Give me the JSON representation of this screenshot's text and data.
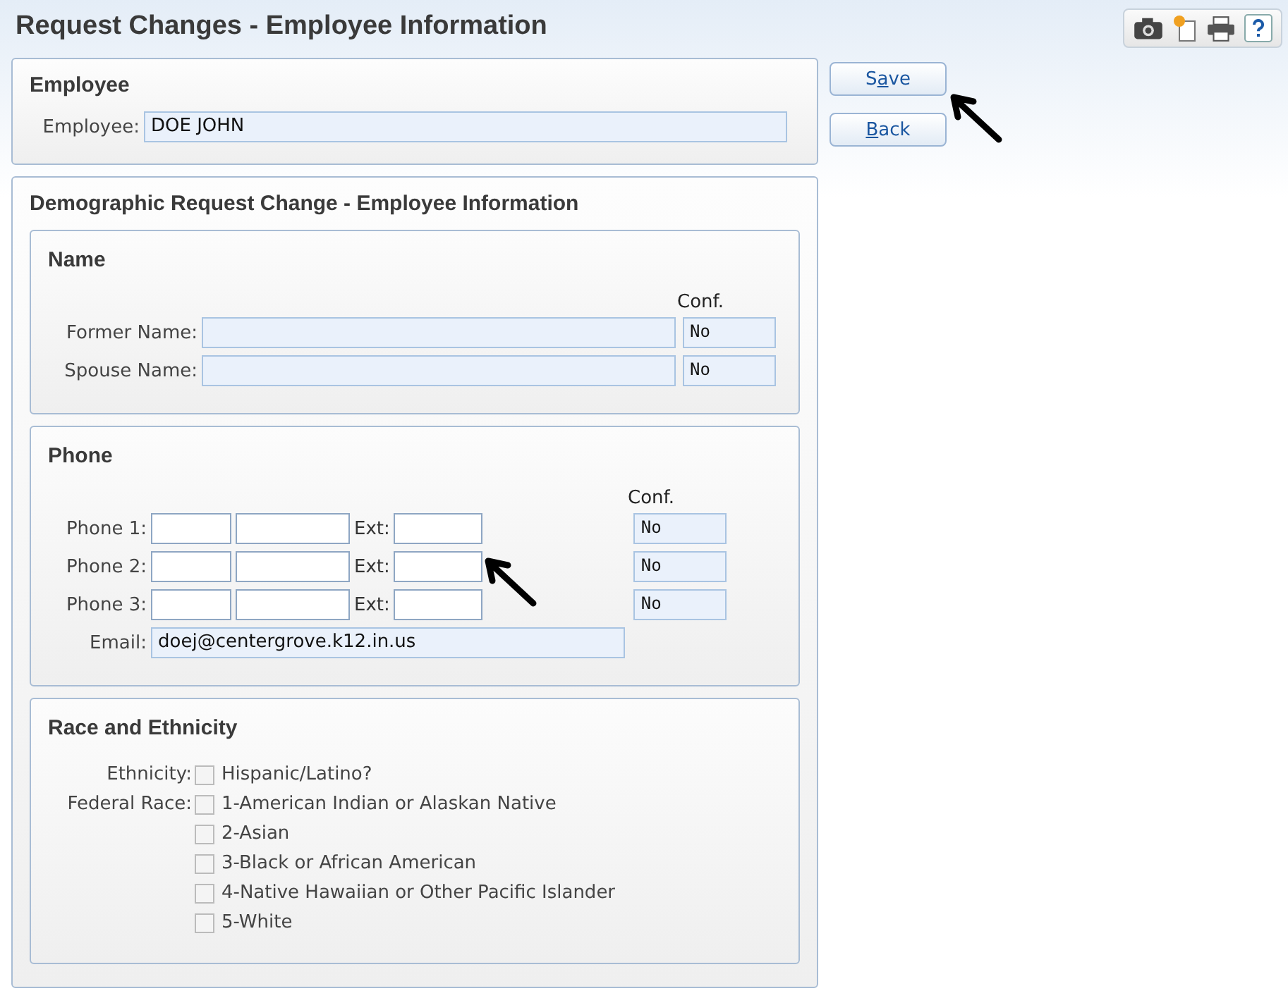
{
  "page_title": "Request Changes - Employee Information",
  "buttons": [
    {
      "before": "S",
      "access_key": "a",
      "after": "ve"
    },
    {
      "access_key": "B",
      "after": "ack"
    }
  ],
  "employee_panel": {
    "title": "Employee",
    "label": "Employee:",
    "value": "DOE JOHN"
  },
  "demographic_panel": {
    "title": "Demographic Request Change - Employee Information",
    "name_section": {
      "title": "Name",
      "conf_header": "Conf.",
      "rows": [
        {
          "label": "Former Name:",
          "conf": "No"
        },
        {
          "label": "Spouse Name:",
          "conf": "No"
        }
      ]
    },
    "phone_section": {
      "title": "Phone",
      "conf_header": "Conf.",
      "rows": [
        {
          "label": "Phone 1:",
          "ext_label": "Ext:",
          "conf": "No"
        },
        {
          "label": "Phone 2:",
          "ext_label": "Ext:",
          "conf": "No"
        },
        {
          "label": "Phone 3:",
          "ext_label": "Ext:",
          "conf": "No"
        }
      ],
      "email_label": "Email:",
      "email": "doej@centergrove.k12.in.us"
    },
    "race_section": {
      "title": "Race and Ethnicity",
      "ethnicity_label": "Ethnicity:",
      "ethnicity": {
        "label": "Hispanic/Latino?",
        "checked": false
      },
      "race_label": "Federal Race:",
      "races": [
        {
          "label": "1-American Indian or Alaskan Native",
          "checked": false
        },
        {
          "label": "2-Asian",
          "checked": false
        },
        {
          "label": "3-Black or African American",
          "checked": false
        },
        {
          "label": "4-Native Hawaiian or Other Pacific Islander",
          "checked": false
        },
        {
          "label": "5-White",
          "checked": false
        }
      ]
    }
  }
}
